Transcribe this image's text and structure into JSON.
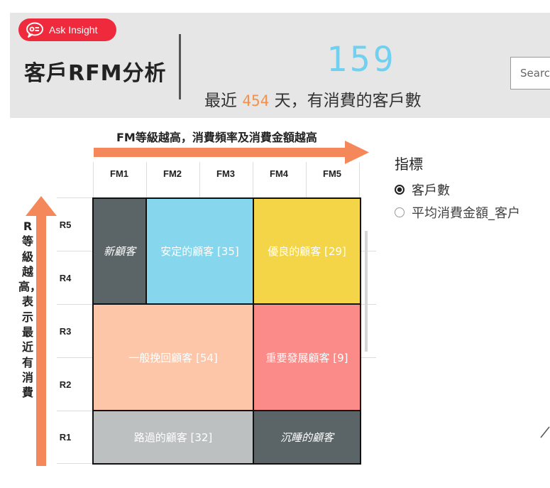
{
  "header": {
    "ask_button_label": "Ask Insight",
    "title": "客戶RFM分析",
    "kpi_value": "159",
    "kpi_prefix": "最近",
    "kpi_days": "454",
    "kpi_suffix": "天，有消費的客戶數",
    "search_placeholder": "Search"
  },
  "matrix": {
    "fm_arrow_label": "FM等級越高，消費頻率及消費金額越高",
    "r_arrow_label": "R等級越高，表示最近有消費",
    "columns": [
      "FM1",
      "FM2",
      "FM3",
      "FM4",
      "FM5"
    ],
    "rows": [
      "R5",
      "R4",
      "R3",
      "R2",
      "R1"
    ],
    "segments": {
      "new": {
        "label": "新顧客",
        "color": "#5b6466"
      },
      "stable": {
        "label": "安定的顧客 [35]",
        "color": "#86d7ee"
      },
      "excellent": {
        "label": "優良的顧客 [29]",
        "color": "#f5d548"
      },
      "general": {
        "label": "一般挽回顧客 [54]",
        "color": "#fdc6a9"
      },
      "important": {
        "label": "重要發展顧客 [9]",
        "color": "#fb8b89"
      },
      "passing": {
        "label": "路過的顧客 [32]",
        "color": "#bcc0c0"
      },
      "sleeping": {
        "label": "沉睡的顧客",
        "color": "#5b6466"
      }
    }
  },
  "legend": {
    "title": "指標",
    "options": [
      {
        "label": "客戶數",
        "selected": true
      },
      {
        "label": "平均消費金額_客户",
        "selected": false
      }
    ]
  },
  "colors": {
    "accent_red": "#ee2a3c",
    "kpi_blue": "#6fd1ef",
    "arrow_orange": "#f5885a"
  }
}
